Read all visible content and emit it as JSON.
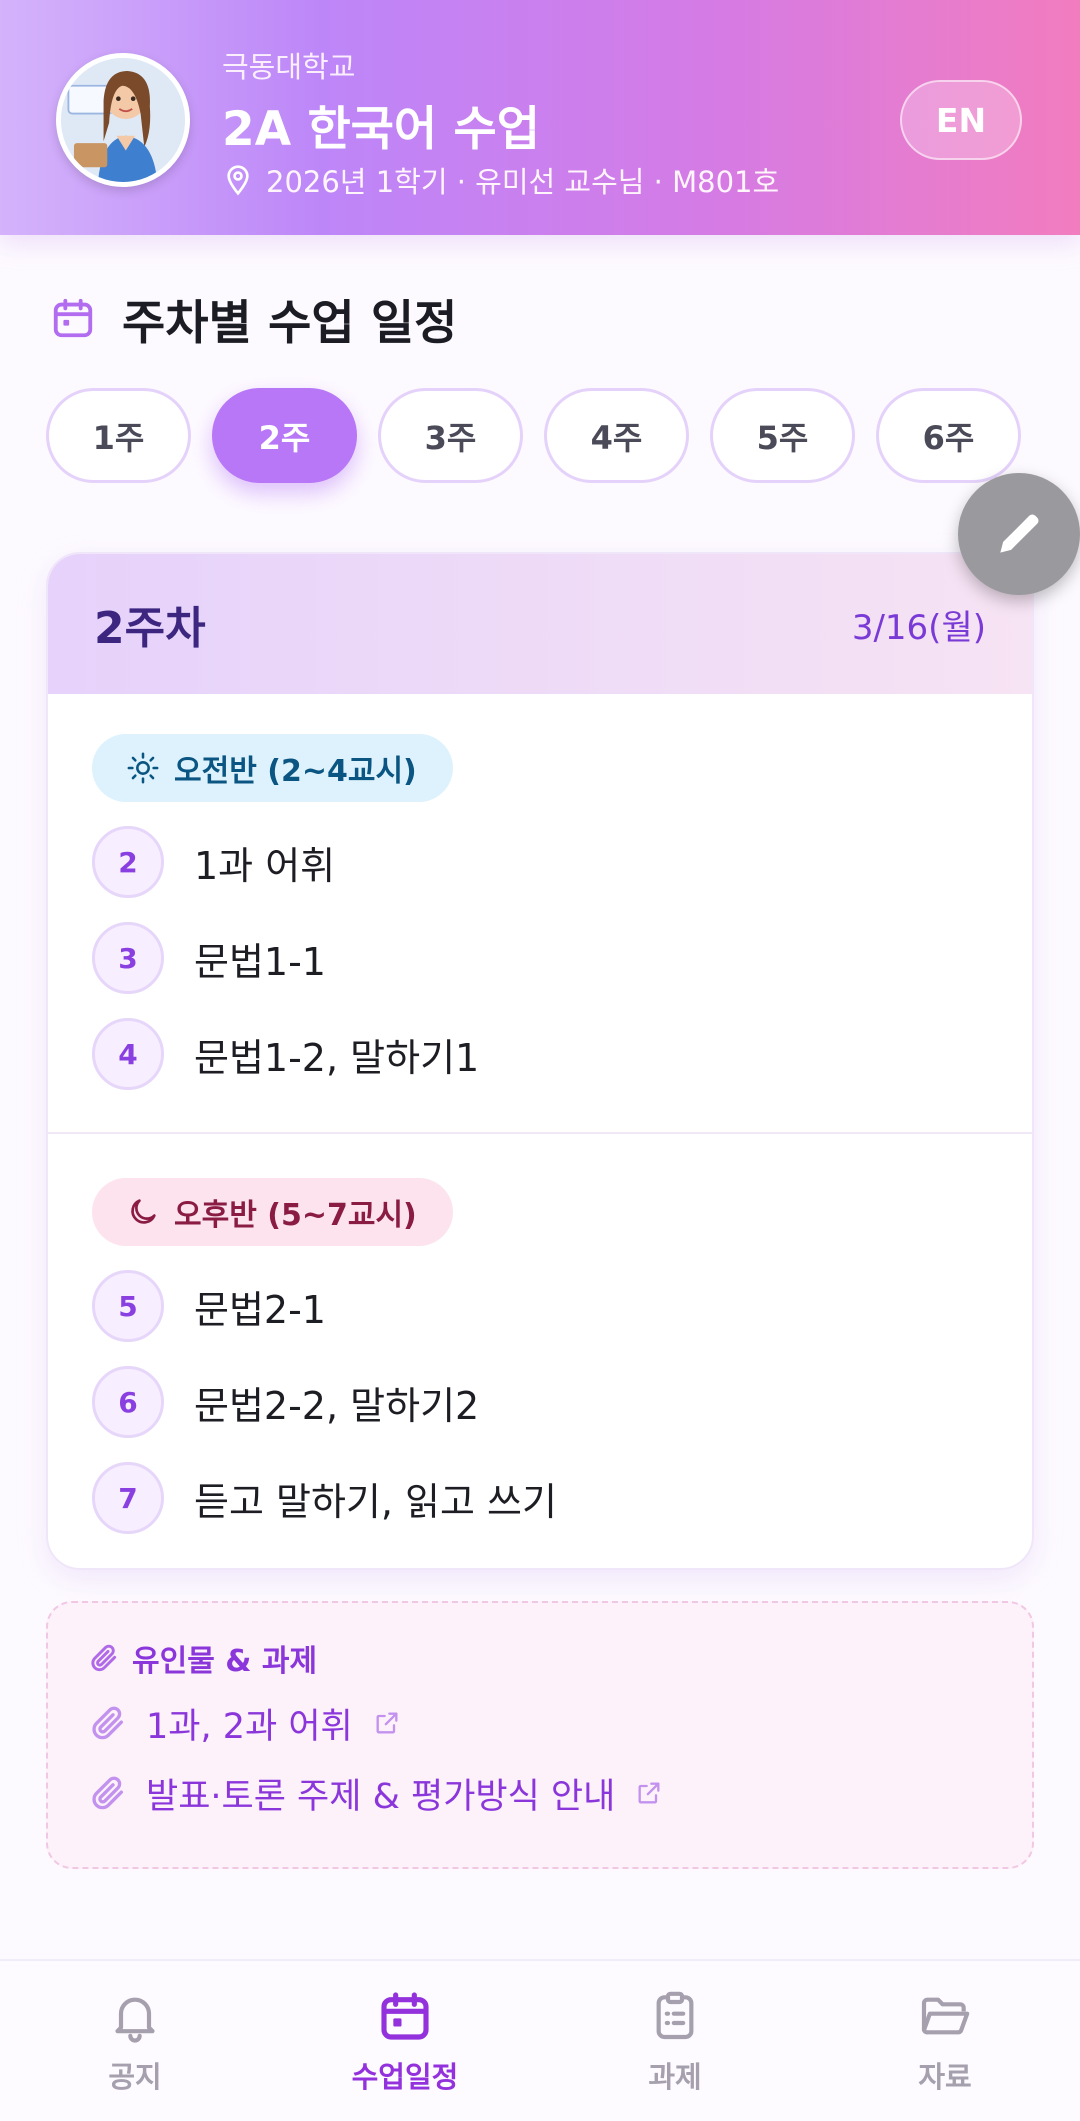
{
  "header": {
    "school": "극동대학교",
    "title": "2A 한국어 수업",
    "meta": "2026년 1학기 · 유미선 교수님 · M801호",
    "lang_button": "EN"
  },
  "schedule": {
    "section_title": "주차별 수업 일정",
    "weeks": [
      "1주",
      "2주",
      "3주",
      "4주",
      "5주",
      "6주"
    ],
    "active_week_index": 1,
    "card": {
      "week_label": "2주차",
      "date": "3/16(월)",
      "morning": {
        "label": "오전반 (2~4교시)",
        "lessons": [
          {
            "period": "2",
            "title": "1과 어휘"
          },
          {
            "period": "3",
            "title": "문법1-1"
          },
          {
            "period": "4",
            "title": "문법1-2, 말하기1"
          }
        ]
      },
      "afternoon": {
        "label": "오후반 (5~7교시)",
        "lessons": [
          {
            "period": "5",
            "title": "문법2-1"
          },
          {
            "period": "6",
            "title": "문법2-2, 말하기2"
          },
          {
            "period": "7",
            "title": "듣고 말하기, 읽고 쓰기"
          }
        ]
      }
    }
  },
  "materials": {
    "title": "유인물 & 과제",
    "items": [
      {
        "label": "1과, 2과 어휘"
      },
      {
        "label": "발표·토론 주제 & 평가방식 안내"
      }
    ]
  },
  "bottom_nav": {
    "items": [
      {
        "label": "공지",
        "icon": "bell-icon"
      },
      {
        "label": "수업일정",
        "icon": "calendar-icon"
      },
      {
        "label": "과제",
        "icon": "clipboard-icon"
      },
      {
        "label": "자료",
        "icon": "folder-icon"
      }
    ],
    "active_index": 1
  },
  "colors": {
    "accent": "#b777f6",
    "accent_text": "#8a36db",
    "morning_badge_bg": "#ddf2fd",
    "afternoon_badge_bg": "#fde3ee"
  }
}
